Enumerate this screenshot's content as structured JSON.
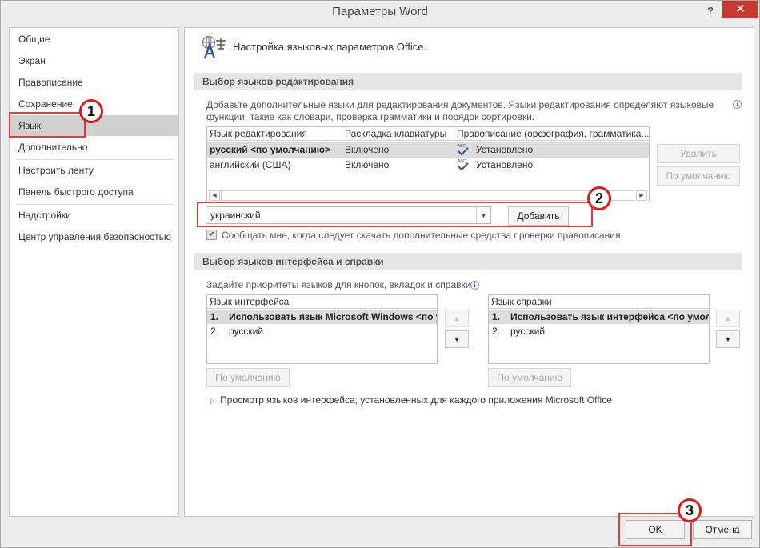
{
  "window": {
    "title": "Параметры Word",
    "help_label": "?",
    "close_label": "✕"
  },
  "sidebar": {
    "items": [
      {
        "label": "Общие"
      },
      {
        "label": "Экран"
      },
      {
        "label": "Правописание"
      },
      {
        "label": "Сохранение"
      },
      {
        "label": "Язык"
      },
      {
        "label": "Дополнительно"
      },
      {
        "label": "Настроить ленту"
      },
      {
        "label": "Панель быстрого доступа"
      },
      {
        "label": "Надстройки"
      },
      {
        "label": "Центр управления безопасностью"
      }
    ],
    "active": "Язык"
  },
  "header": {
    "text": "Настройка языковых параметров Office."
  },
  "editing": {
    "section_title": "Выбор языков редактирования",
    "description": "Добавьте дополнительные языки для редактирования документов. Языки редактирования определяют языковые функции, такие как словари, проверка грамматики и порядок сортировки.",
    "columns": [
      "Язык редактирования",
      "Раскладка клавиатуры",
      "Правописание (орфография, грамматика..."
    ],
    "rows": [
      {
        "language": "русский <по умолчанию>",
        "keyboard": "Включено",
        "proofing": "Установлено",
        "selected": true
      },
      {
        "language": "английский (США)",
        "keyboard": "Включено",
        "proofing": "Установлено",
        "selected": false
      }
    ],
    "proofing_icon_text": "ABC",
    "remove_label": "Удалить",
    "default_label": "По умолчанию",
    "combo_value": "украинский",
    "add_label": "Добавить",
    "notify_label": "Сообщать мне, когда следует скачать дополнительные средства проверки правописания",
    "notify_checked": true
  },
  "ui_lang": {
    "section_title": "Выбор языков интерфейса и справки",
    "description": "Задайте приоритеты языков для кнопок, вкладок и справки",
    "display": {
      "header": "Язык интерфейса",
      "items": [
        {
          "num": "1.",
          "text": "Использовать язык Microsoft Windows <по у",
          "bold": true
        },
        {
          "num": "2.",
          "text": "русский",
          "bold": false
        }
      ],
      "default_label": "По умолчанию"
    },
    "help": {
      "header": "Язык справки",
      "items": [
        {
          "num": "1.",
          "text": "Использовать язык интерфейса <по умолч",
          "bold": true
        },
        {
          "num": "2.",
          "text": "русский",
          "bold": false
        }
      ],
      "default_label": "По умолчанию"
    },
    "expander_label": "Просмотр языков интерфейса, установленных для каждого приложения Microsoft Office"
  },
  "footer": {
    "ok_label": "OK",
    "cancel_label": "Отмена"
  },
  "callouts": [
    "1",
    "2",
    "3"
  ],
  "colors": {
    "accent": "#2b579a",
    "callout": "#e23a3a",
    "close": "#c73a31"
  }
}
